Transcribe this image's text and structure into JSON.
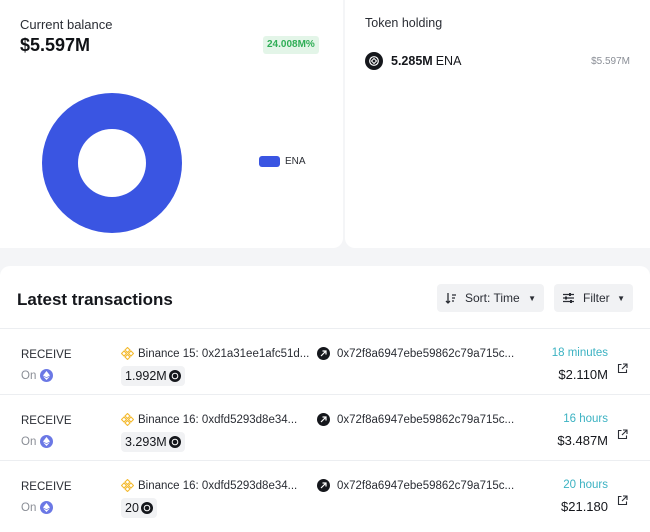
{
  "balance": {
    "label": "Current balance",
    "value": "$5.597M",
    "change": "24.008M%",
    "chart": {
      "segments": [
        {
          "name": "ENA",
          "fraction": 1.0,
          "color": "#3a55e2"
        }
      ]
    },
    "legend": [
      {
        "label": "ENA",
        "color": "#3a55e2"
      }
    ]
  },
  "holding": {
    "title": "Token holding",
    "items": [
      {
        "amount": "5.285M",
        "symbol": "ENA",
        "usd": "$5.597M"
      }
    ]
  },
  "transactions": {
    "title": "Latest transactions",
    "sort_label": "Sort: Time",
    "filter_label": "Filter",
    "rows": [
      {
        "type": "RECEIVE",
        "on_label": "On",
        "from": "Binance 15: 0x21a31ee1afc51d...",
        "amount": "1.992M",
        "to": "0x72f8a6947ebe59862c79a715c...",
        "time": "18 minutes",
        "usd": "$2.110M"
      },
      {
        "type": "RECEIVE",
        "on_label": "On",
        "from": "Binance 16: 0xdfd5293d8e34...",
        "amount": "3.293M",
        "to": "0x72f8a6947ebe59862c79a715c...",
        "time": "16 hours",
        "usd": "$3.487M"
      },
      {
        "type": "RECEIVE",
        "on_label": "On",
        "from": "Binance 16: 0xdfd5293d8e34...",
        "amount": "20",
        "to": "0x72f8a6947ebe59862c79a715c...",
        "time": "20 hours",
        "usd": "$21.180"
      }
    ]
  },
  "colors": {
    "accent": "#3a55e2",
    "positive": "#2fae56",
    "time": "#3bb2c2",
    "binance": "#f3ba2f"
  },
  "icons": [
    "ena-token-icon",
    "ethereum-icon",
    "binance-icon",
    "arrow-up-right-icon",
    "external-link-icon",
    "sort-icon",
    "filter-icon",
    "chevron-down-icon"
  ]
}
